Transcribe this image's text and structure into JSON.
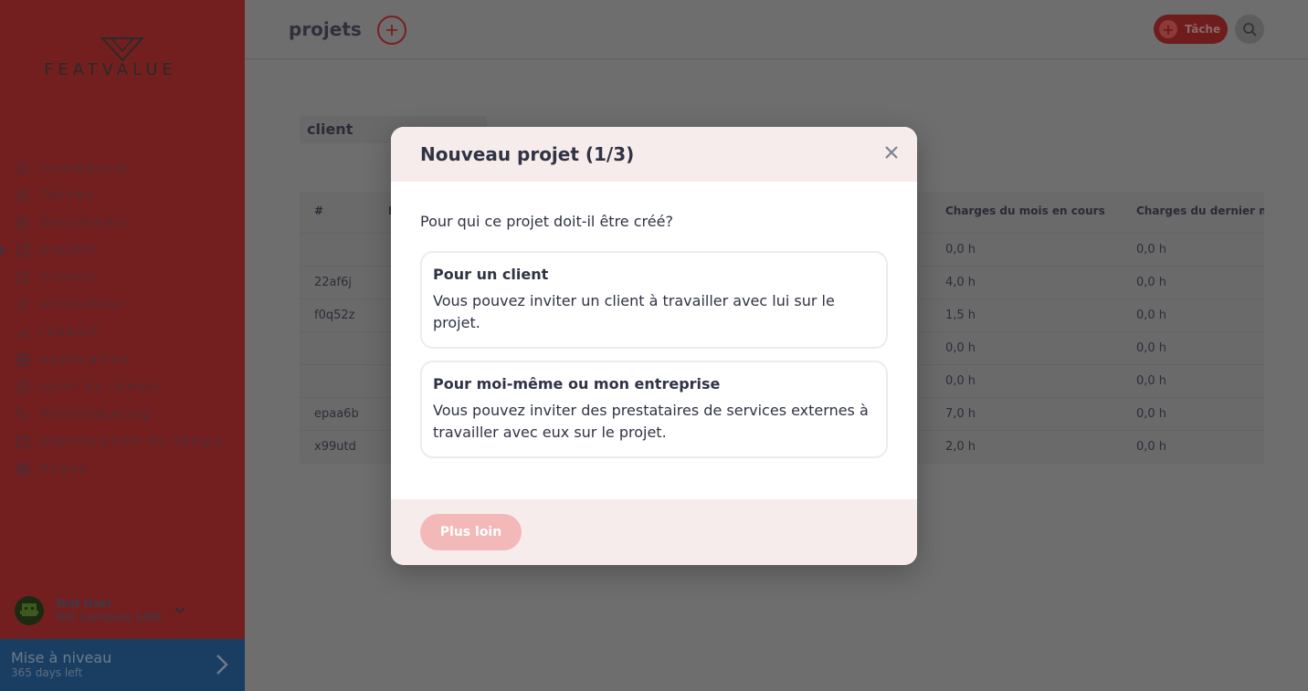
{
  "sidebar": {
    "logo_text": "FEATVALUE",
    "items": [
      {
        "label": "commencer",
        "icon": "home-icon"
      },
      {
        "label": "Tâches",
        "icon": "list-icon"
      },
      {
        "label": "Documents",
        "icon": "document-icon"
      },
      {
        "label": "projets",
        "icon": "chart-icon",
        "active": true
      },
      {
        "label": "Clients",
        "icon": "building-icon"
      },
      {
        "label": "utilisateur",
        "icon": "user-icon"
      },
      {
        "label": "rapport",
        "icon": "report-icon"
      },
      {
        "label": "application",
        "icon": "grid-icon"
      },
      {
        "label": "suivi du temps",
        "icon": "clock-icon"
      },
      {
        "label": "Whitelabeling",
        "icon": "tag-icon"
      },
      {
        "label": "planification du temps",
        "icon": "calendar-icon"
      },
      {
        "label": "Asana",
        "icon": "grid-icon"
      }
    ],
    "user": {
      "name": "Test User",
      "company": "Test Company SARL"
    },
    "upgrade": {
      "title": "Mise à niveau",
      "subtitle": "365 days left"
    }
  },
  "header": {
    "title": "projets",
    "task_button_label": "Tâche"
  },
  "filter": {
    "value": "client"
  },
  "table": {
    "columns": [
      "#",
      "N",
      "Charges du mois en cours",
      "Charges du dernier m"
    ],
    "rows": [
      {
        "id": "",
        "current": "0,0 h",
        "last": "0,0 h"
      },
      {
        "id": "22af6j",
        "current": "4,0 h",
        "last": "0,0 h"
      },
      {
        "id": "f0q52z",
        "current": "1,5 h",
        "last": "0,0 h"
      },
      {
        "id": "",
        "current": "0,0 h",
        "last": "0,0 h"
      },
      {
        "id": "",
        "current": "0,0 h",
        "last": "0,0 h"
      },
      {
        "id": "epaa6b",
        "current": "7,0 h",
        "last": "0,0 h"
      },
      {
        "id": "x99utd",
        "current": "2,0 h",
        "last": "0,0 h"
      }
    ]
  },
  "modal": {
    "title": "Nouveau projet (1/3)",
    "question": "Pour qui ce projet doit-il être créé?",
    "options": [
      {
        "title": "Pour un client",
        "description": "Vous pouvez inviter un client à travailler avec lui sur le projet."
      },
      {
        "title": "Pour moi-même ou mon entreprise",
        "description": "Vous pouvez inviter des prestataires de services externes à travailler avec eux sur le projet."
      }
    ],
    "next_label": "Plus loin"
  },
  "colors": {
    "sidebar_bg": "#741f1f",
    "accent": "#7a1f1f",
    "modal_header_bg": "#f7ecec",
    "next_button": "#f3b8b8",
    "upgrade_bg": "#1a3e62"
  }
}
